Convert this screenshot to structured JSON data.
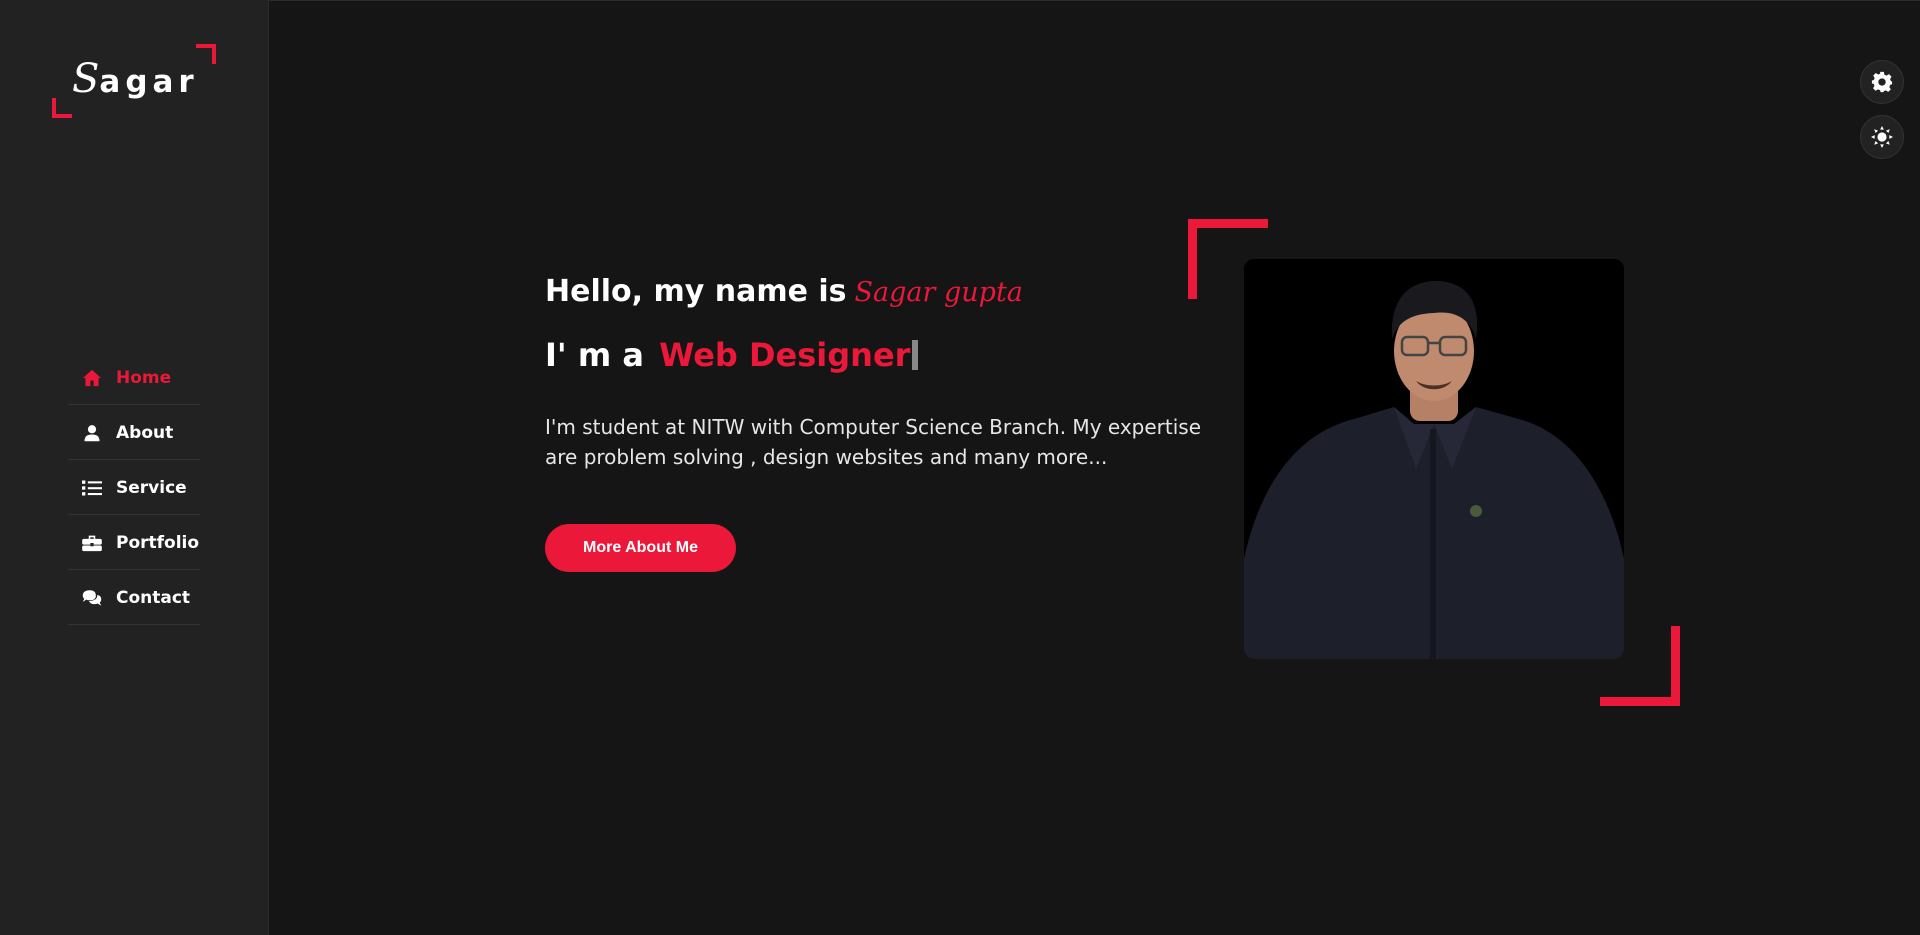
{
  "brand": {
    "logo_first": "S",
    "logo_rest": "agar"
  },
  "sidebar": {
    "items": [
      {
        "label": "Home",
        "icon": "home-icon",
        "active": true
      },
      {
        "label": "About",
        "icon": "user-icon",
        "active": false
      },
      {
        "label": "Service",
        "icon": "list-icon",
        "active": false
      },
      {
        "label": "Portfolio",
        "icon": "briefcase-icon",
        "active": false
      },
      {
        "label": "Contact",
        "icon": "comments-icon",
        "active": false
      }
    ]
  },
  "controls": {
    "settings_icon": "gear-icon",
    "theme_icon": "sun-icon"
  },
  "hero": {
    "greeting": "Hello, my name is",
    "name": "Sagar gupta",
    "role_prefix": "I' m a",
    "role": "Web Designer",
    "intro": "I'm student at NITW with Computer Science Branch. My expertise are problem solving , design websites and many more...",
    "button_label": "More About Me"
  },
  "colors": {
    "accent": "#ec1839",
    "background": "#151515",
    "sidebar": "#222222"
  }
}
